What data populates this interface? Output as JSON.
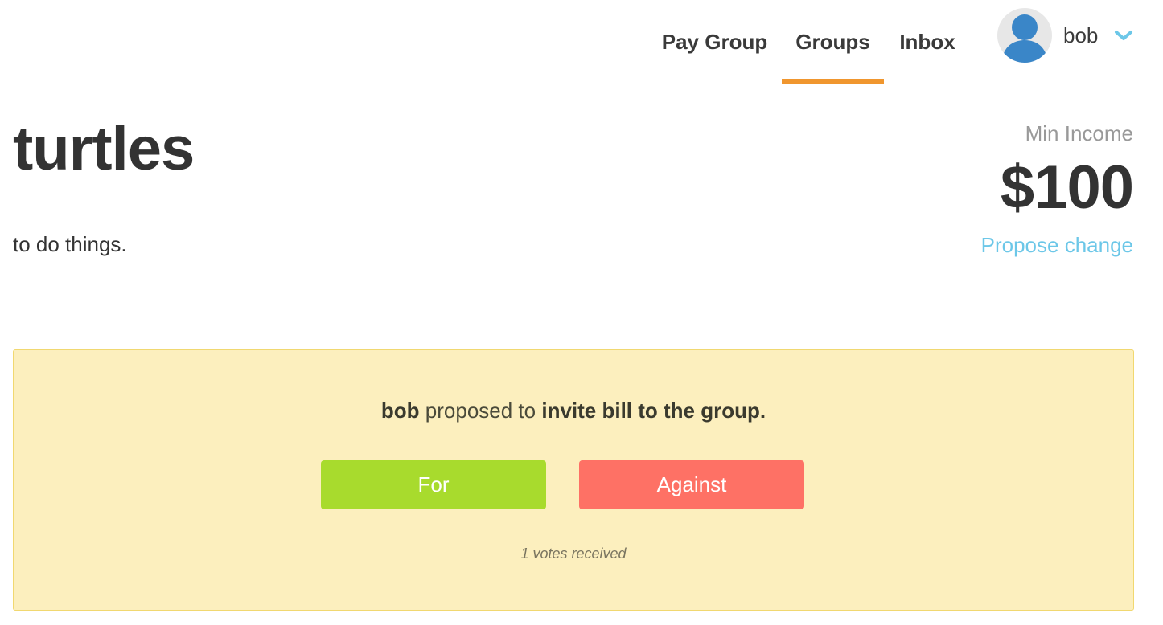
{
  "nav": {
    "items": [
      {
        "label": "Pay Group"
      },
      {
        "label": "Groups",
        "active": true
      },
      {
        "label": "Inbox"
      }
    ],
    "active_color": "#f0962e"
  },
  "user": {
    "name": "bob",
    "avatar_icon": "user-avatar-icon",
    "menu_icon": "chevron-down-icon"
  },
  "group": {
    "title": "turtles",
    "description": "to do things."
  },
  "income": {
    "label": "Min Income",
    "value": "$100",
    "propose_label": "Propose change",
    "link_color": "#6cc7e8"
  },
  "proposal": {
    "proposer": "bob",
    "verb": "proposed to",
    "action": "invite bill to the group.",
    "for_label": "For",
    "against_label": "Against",
    "votes_text": "1 votes received",
    "for_color": "#a8db2d",
    "against_color": "#fe7165",
    "card_color": "#fcefbe"
  }
}
